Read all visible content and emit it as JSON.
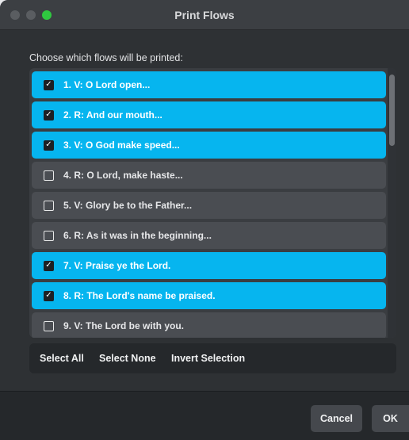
{
  "window": {
    "title": "Print Flows"
  },
  "prompt": "Choose which flows will be printed:",
  "flows": [
    {
      "label": "1. V: O Lord open...",
      "checked": true
    },
    {
      "label": "2. R: And our mouth...",
      "checked": true
    },
    {
      "label": "3. V: O God make speed...",
      "checked": true
    },
    {
      "label": "4. R: O Lord, make haste...",
      "checked": false
    },
    {
      "label": "5. V: Glory be to the Father...",
      "checked": false
    },
    {
      "label": "6. R: As it was in the beginning...",
      "checked": false
    },
    {
      "label": "7. V: Praise ye the Lord.",
      "checked": true
    },
    {
      "label": "8. R: The Lord's name be praised.",
      "checked": true
    },
    {
      "label": "9. V: The Lord be with you.",
      "checked": false
    }
  ],
  "selection": {
    "select_all": "Select All",
    "select_none": "Select None",
    "invert": "Invert Selection"
  },
  "footer": {
    "cancel": "Cancel",
    "ok": "OK"
  },
  "colors": {
    "selected_row": "#06b5ef",
    "unselected_row": "#4a4d52",
    "zoom_button": "#2fc840"
  }
}
